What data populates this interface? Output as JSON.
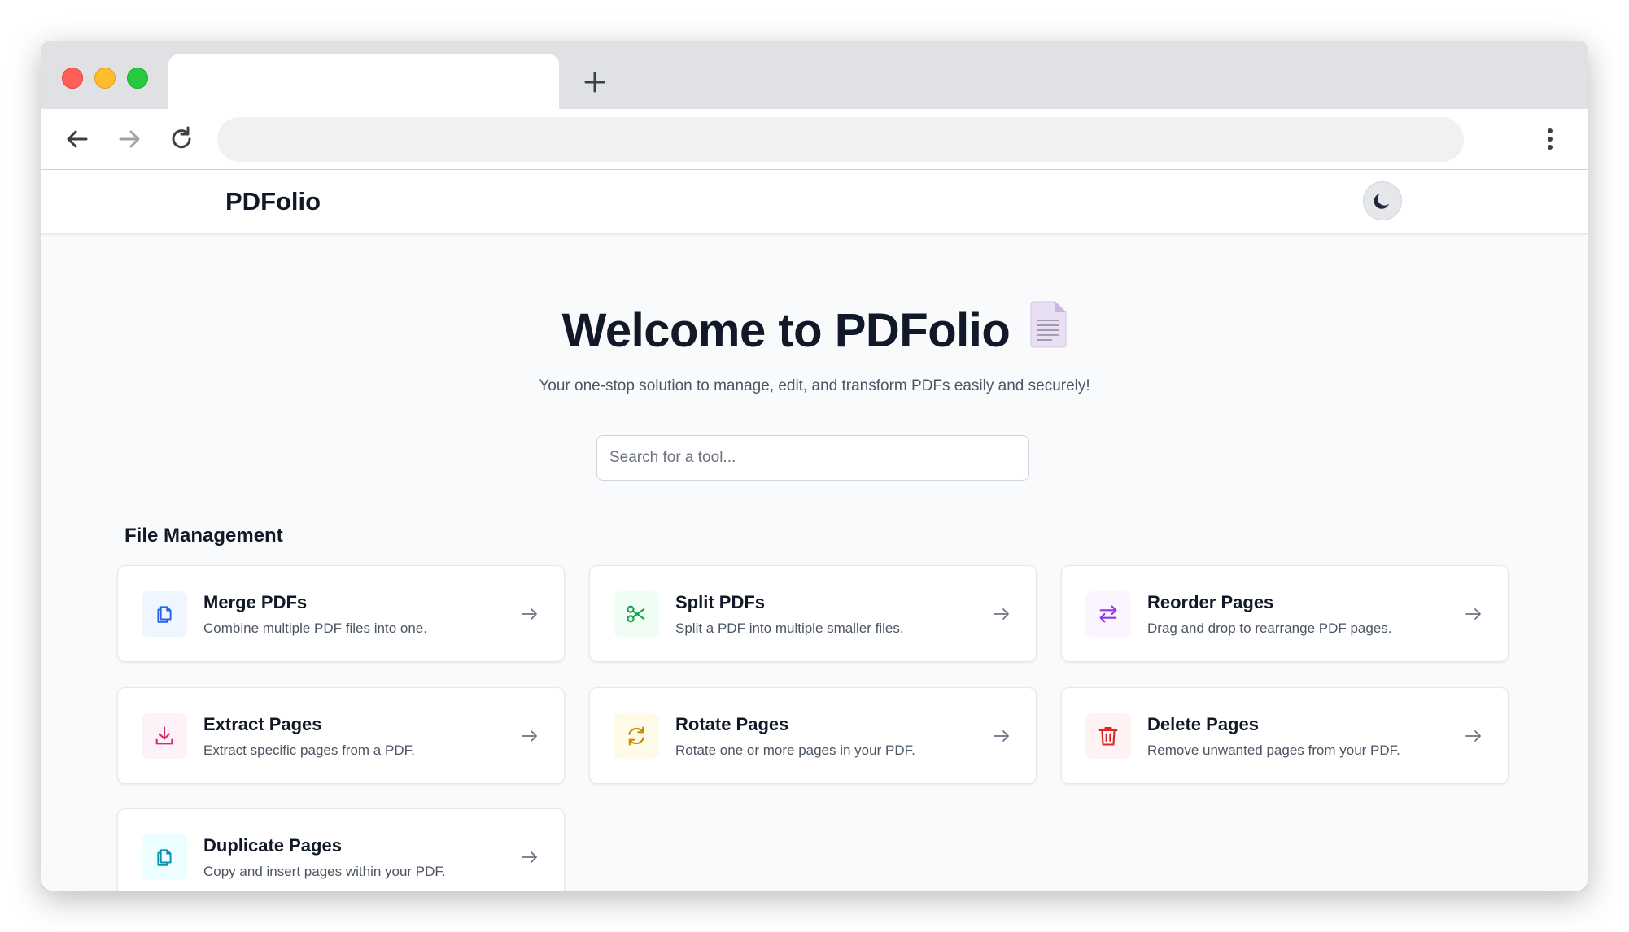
{
  "browser": {
    "tab_title": "",
    "address": ""
  },
  "app": {
    "brand": "PDFolio",
    "theme_toggle_icon": "moon-icon"
  },
  "hero": {
    "title": "Welcome to PDFolio",
    "title_icon": "document-icon",
    "subtitle": "Your one-stop solution to manage, edit, and transform PDFs easily and securely!"
  },
  "search": {
    "placeholder": "Search for a tool...",
    "value": ""
  },
  "section": {
    "title": "File Management"
  },
  "tools": [
    {
      "title": "Merge PDFs",
      "description": "Combine multiple PDF files into one.",
      "icon": "copy-icon",
      "color": "#2563eb",
      "bg": "#eff6ff"
    },
    {
      "title": "Split PDFs",
      "description": "Split a PDF into multiple smaller files.",
      "icon": "scissors-icon",
      "color": "#16a34a",
      "bg": "#f0fdf4"
    },
    {
      "title": "Reorder Pages",
      "description": "Drag and drop to rearrange PDF pages.",
      "icon": "swap-arrows-icon",
      "color": "#9333ea",
      "bg": "#faf5ff"
    },
    {
      "title": "Extract Pages",
      "description": "Extract specific pages from a PDF.",
      "icon": "download-icon",
      "color": "#db2777",
      "bg": "#fdf2f8"
    },
    {
      "title": "Rotate Pages",
      "description": "Rotate one or more pages in your PDF.",
      "icon": "rotate-icon",
      "color": "#ca8a04",
      "bg": "#fefce8"
    },
    {
      "title": "Delete Pages",
      "description": "Remove unwanted pages from your PDF.",
      "icon": "trash-icon",
      "color": "#dc2626",
      "bg": "#fef2f2"
    },
    {
      "title": "Duplicate Pages",
      "description": "Copy and insert pages within your PDF.",
      "icon": "duplicate-icon",
      "color": "#0891b2",
      "bg": "#ecfeff"
    }
  ]
}
